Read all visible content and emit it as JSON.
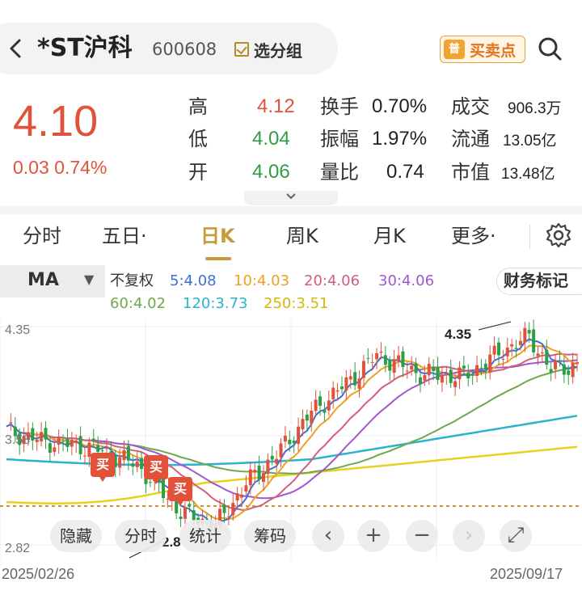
{
  "header": {
    "name": "*ST沪科",
    "code": "600608",
    "group_label": "选分组",
    "trade_icon_text": "普",
    "trade_label": "买卖点"
  },
  "quote": {
    "price": "4.10",
    "change": "0.03  0.74%",
    "high_label": "高",
    "high": "4.12",
    "low_label": "低",
    "low": "4.04",
    "open_label": "开",
    "open": "4.06",
    "turnover_label": "换手",
    "turnover": "0.70%",
    "amplitude_label": "振幅",
    "amplitude": "1.97%",
    "volratio_label": "量比",
    "volratio": "0.74",
    "volume_label": "成交",
    "volume": "906.3万",
    "float_label": "流通",
    "float_cap": "13.05亿",
    "mcap_label": "市值",
    "mcap": "13.48亿",
    "expand_icon": "chevron-down"
  },
  "tabs": [
    {
      "label": "分时"
    },
    {
      "label": "五日·"
    },
    {
      "label": "日K"
    },
    {
      "label": "周K"
    },
    {
      "label": "月K"
    },
    {
      "label": "更多·"
    }
  ],
  "ma_bar": {
    "select": "MA",
    "fq": "不复权",
    "ma5": "5:4.08",
    "ma10": "10:4.03",
    "ma20": "20:4.06",
    "ma30": "30:4.06",
    "ma60": "60:4.02",
    "ma120": "120:3.73",
    "ma250": "250:3.51",
    "finance_label": "财务标记"
  },
  "colors": {
    "up": "#e0533a",
    "down": "#2e9e46",
    "ma5": "#3d6fd6",
    "ma10": "#f0a020",
    "ma20": "#d0607a",
    "ma30": "#a057d0",
    "ma60": "#6fa84d",
    "ma120": "#2ab3cc",
    "ma250": "#e6d020"
  },
  "chart": {
    "y_top": "4.35",
    "y_mid": "3.58",
    "y_bottom": "2.82",
    "date_start": "2025/02/26",
    "date_end": "2025/09/17",
    "max_annotation": "4.35",
    "min_annotation": "2.8",
    "buy_tag": "买"
  },
  "chart_data": {
    "type": "candlestick",
    "x_range": [
      "2025/02/26",
      "2025/09/17"
    ],
    "y_range": [
      2.82,
      4.35
    ],
    "y_ticks": [
      4.35,
      3.58,
      2.82
    ],
    "period_high": 4.35,
    "period_low": 2.8,
    "ma_latest": {
      "MA5": 4.08,
      "MA10": 4.03,
      "MA20": 4.06,
      "MA30": 4.06,
      "MA60": 4.02,
      "MA120": 3.73,
      "MA250": 3.51
    }
  },
  "toolbar": {
    "hide": "隐藏",
    "intraday": "分时",
    "stats": "统计",
    "chips": "筹码",
    "prev": "‹",
    "zoom_in": "+",
    "zoom_out": "−",
    "next": "›",
    "fullscreen": "⤢"
  }
}
